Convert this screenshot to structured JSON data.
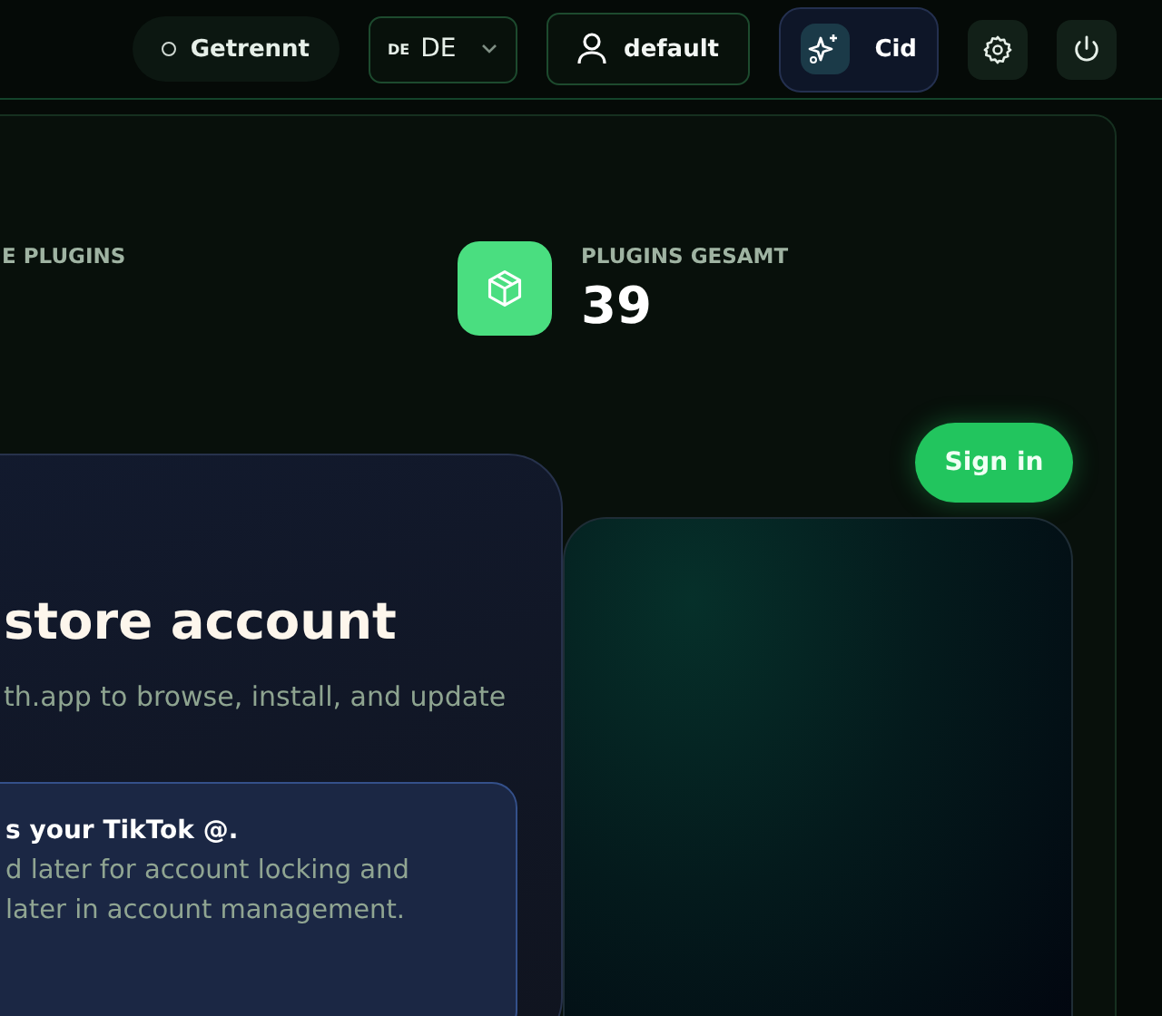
{
  "header": {
    "status": {
      "label": "Getrennt",
      "connected": false
    },
    "language": {
      "flag": "DE",
      "code": "DE"
    },
    "profile": {
      "label": "default"
    },
    "assistant": {
      "label": "Cid"
    }
  },
  "stats": [
    {
      "label": "E PLUGINS",
      "icon_shown": false
    },
    {
      "label": "PLUGINS GESAMT",
      "value": "39",
      "icon_shown": true
    }
  ],
  "sign_in": {
    "label": "Sign in"
  },
  "account_card": {
    "title": "store account",
    "subtitle": "th.app to browse, install, and update",
    "notice": {
      "title": "s your TikTok @.",
      "lines": [
        "d later for account locking and",
        "later in account management."
      ]
    }
  }
}
